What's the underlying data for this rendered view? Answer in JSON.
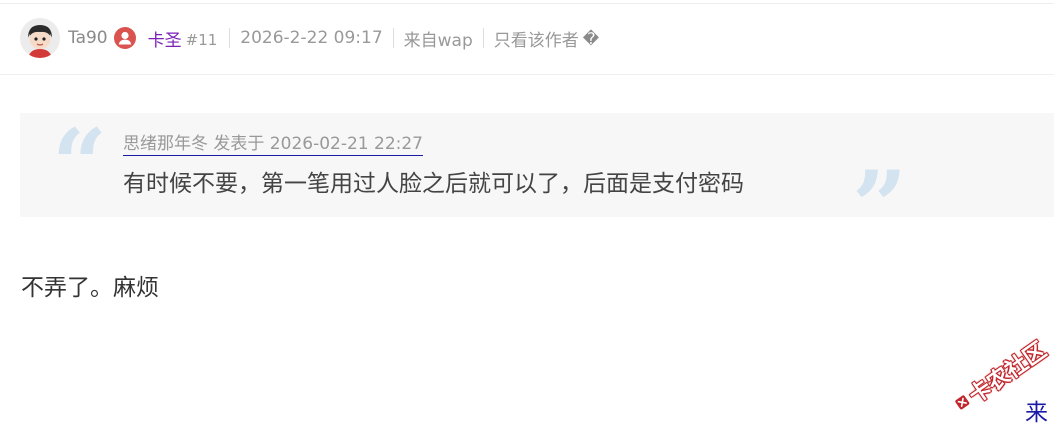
{
  "header": {
    "username": "Ta90",
    "group": "卡圣",
    "floor": "#11",
    "datetime": "2026-2-22 09:17",
    "source": "来自wap",
    "only_author": "只看该作者",
    "only_author_icon": "�"
  },
  "icons": {
    "avatar": "avatar-cartoon-boy",
    "user_badge": "user-icon",
    "user_badge_color": "#d9534f",
    "group_color": "#7a20b8"
  },
  "quote": {
    "open_mark": "“",
    "close_mark": "”",
    "source": "思绪那年冬 发表于 2026-02-21 22:27",
    "text": "有时候不要，第一笔用过人脸之后就可以了，后面是支付密码"
  },
  "post": {
    "body": "不弄了。麻烦"
  },
  "watermark": {
    "text": "卡农社区",
    "color": "#c0262b"
  },
  "footer": {
    "link_text": "来"
  }
}
